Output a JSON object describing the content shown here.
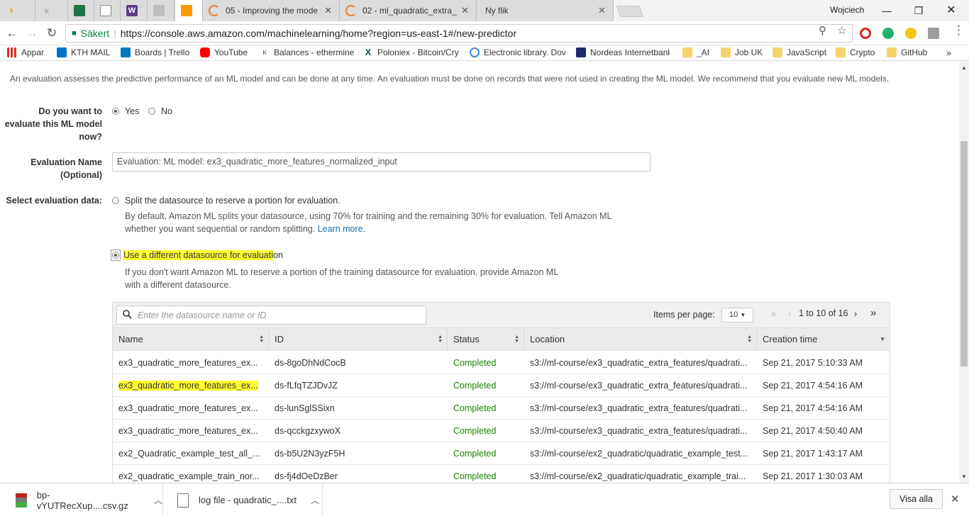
{
  "browser": {
    "tabs": [
      {
        "title": "",
        "icon": "aws-orange-icon",
        "color": "#ff9900",
        "active": false
      },
      {
        "title": "",
        "icon": "generic-page-icon",
        "color": "#9e9e9e",
        "active": false
      },
      {
        "title": "",
        "icon": "spreadsheet-icon",
        "color": "#217346",
        "active": false
      },
      {
        "title": "",
        "icon": "doc-page-icon",
        "color": "#888888",
        "active": false
      },
      {
        "title": "",
        "icon": "w-logo-icon",
        "color": "#5b3a86",
        "active": false
      },
      {
        "title": "",
        "icon": "image-icon",
        "color": "#8a8a8a",
        "active": false
      },
      {
        "title": "",
        "icon": "aws-box-icon",
        "color": "#ff9900",
        "active": true
      },
      {
        "title": "05 - Improving the mode",
        "icon": "loading-icon",
        "color": "#f08030",
        "active": false
      },
      {
        "title": "02 - ml_quadratic_extra_",
        "icon": "loading-icon",
        "color": "#f08030",
        "active": false
      },
      {
        "title": "Ny flik",
        "icon": "",
        "color": "",
        "active": false
      }
    ],
    "user": "Wojciech",
    "secure_label": "Säkert",
    "url": "https://console.aws.amazon.com/machinelearning/home?region=us-east-1#/new-predictor",
    "bookmarks": [
      {
        "label": "Appar",
        "color": "#d93025"
      },
      {
        "label": "KTH MAIL",
        "color": "#0072c6"
      },
      {
        "label": "Boards | Trello",
        "color": "#0079bf"
      },
      {
        "label": "YouTube",
        "color": "#ff0000"
      },
      {
        "label": "Balances - ethermine",
        "color": "#666666"
      },
      {
        "label": "Poloniex - Bitcoin/Cry",
        "color": "#1d4a5a"
      },
      {
        "label": "Electronic library. Dov",
        "color": "#3b8ad8"
      },
      {
        "label": "Nordeas Internetbank",
        "color": "#1a2a6c"
      },
      {
        "label": "_AI",
        "color": "#f5d36a"
      },
      {
        "label": "Job UK",
        "color": "#f5d36a"
      },
      {
        "label": "JavaScript",
        "color": "#f5d36a"
      },
      {
        "label": "Crypto",
        "color": "#f5d36a"
      },
      {
        "label": "GitHub",
        "color": "#f5d36a"
      }
    ],
    "more_bookmarks": "»"
  },
  "form": {
    "intro": "An evaluation assesses the predictive performance of an ML model and can be done at any time. An evaluation must be done on records that were not used in creating the ML model. We recommend that you evaluate new ML models.",
    "evaluate_label_1": "Do you want to",
    "evaluate_label_2": "evaluate this ML model",
    "evaluate_label_3": "now?",
    "yes": "Yes",
    "no": "No",
    "name_label_1": "Evaluation Name",
    "name_label_2": "(Optional)",
    "name_value": "Evaluation: ML model: ex3_quadratic_more_features_normalized_input",
    "select_label": "Select evaluation data:",
    "split_option": "Split the datasource to reserve a portion for evaluation.",
    "split_desc_1": "By default, Amazon ML splits your datasource, using 70% for training and the remaining 30% for evaluation. Tell Amazon ML",
    "split_desc_2": "whether you want sequential or random splitting.",
    "learn_more": "Learn more.",
    "different_option_hl": "Use a different datasource for evaluati",
    "different_option_rest": "on",
    "different_desc_1": "If you don't want Amazon ML to reserve a portion of the training datasource for evaluation, provide Amazon ML",
    "different_desc_2": "with a different datasource."
  },
  "table": {
    "search_placeholder": "Enter the datasource name or ID",
    "items_per_page_label": "Items per page:",
    "items_per_page_value": "10",
    "pagination": "1 to 10 of 16",
    "first_page": "«",
    "prev_page": "‹",
    "next_page": "›",
    "last_page": "»",
    "headers": {
      "name": "Name",
      "id": "ID",
      "status": "Status",
      "location": "Location",
      "created": "Creation time"
    },
    "rows": [
      {
        "name": "ex3_quadratic_more_features_ex...",
        "id": "ds-8goDhNdCocB",
        "status": "Completed",
        "location": "s3://ml-course/ex3_quadratic_extra_features/quadrati...",
        "created": "Sep 21, 2017 5:10:33 AM",
        "highlight": false
      },
      {
        "name": "ex3_quadratic_more_features_ex...",
        "id": "ds-fLfqTZJDvJZ",
        "status": "Completed",
        "location": "s3://ml-course/ex3_quadratic_extra_features/quadrati...",
        "created": "Sep 21, 2017 4:54:16 AM",
        "highlight": true
      },
      {
        "name": "ex3_quadratic_more_features_ex...",
        "id": "ds-lunSglSSixn",
        "status": "Completed",
        "location": "s3://ml-course/ex3_quadratic_extra_features/quadrati...",
        "created": "Sep 21, 2017 4:54:16 AM",
        "highlight": false
      },
      {
        "name": "ex3_quadratic_more_features_ex...",
        "id": "ds-qcckgzxywoX",
        "status": "Completed",
        "location": "s3://ml-course/ex3_quadratic_extra_features/quadrati...",
        "created": "Sep 21, 2017 4:50:40 AM",
        "highlight": false
      },
      {
        "name": "ex2_Quadratic_example_test_all_...",
        "id": "ds-b5U2N3yzF5H",
        "status": "Completed",
        "location": "s3://ml-course/ex2_quadratic/quadratic_example_test...",
        "created": "Sep 21, 2017 1:43:17 AM",
        "highlight": false
      },
      {
        "name": "ex2_quadratic_example_train_nor...",
        "id": "ds-fj4dOeDzBer",
        "status": "Completed",
        "location": "s3://ml-course/ex2_quadratic/quadratic_example_trai...",
        "created": "Sep 21, 2017 1:30:03 AM",
        "highlight": false
      }
    ]
  },
  "downloads": {
    "items": [
      {
        "name": "bp-vYUTRecXup....csv.gz",
        "icon": "archive-icon"
      },
      {
        "name": "log file - quadratic_....txt",
        "icon": "text-file-icon"
      }
    ],
    "show_all": "Visa alla"
  },
  "colors": {
    "highlight": "#ffff2e",
    "status_ok": "#1d8102",
    "link": "#1a6aa5",
    "secure": "#0b8043"
  }
}
